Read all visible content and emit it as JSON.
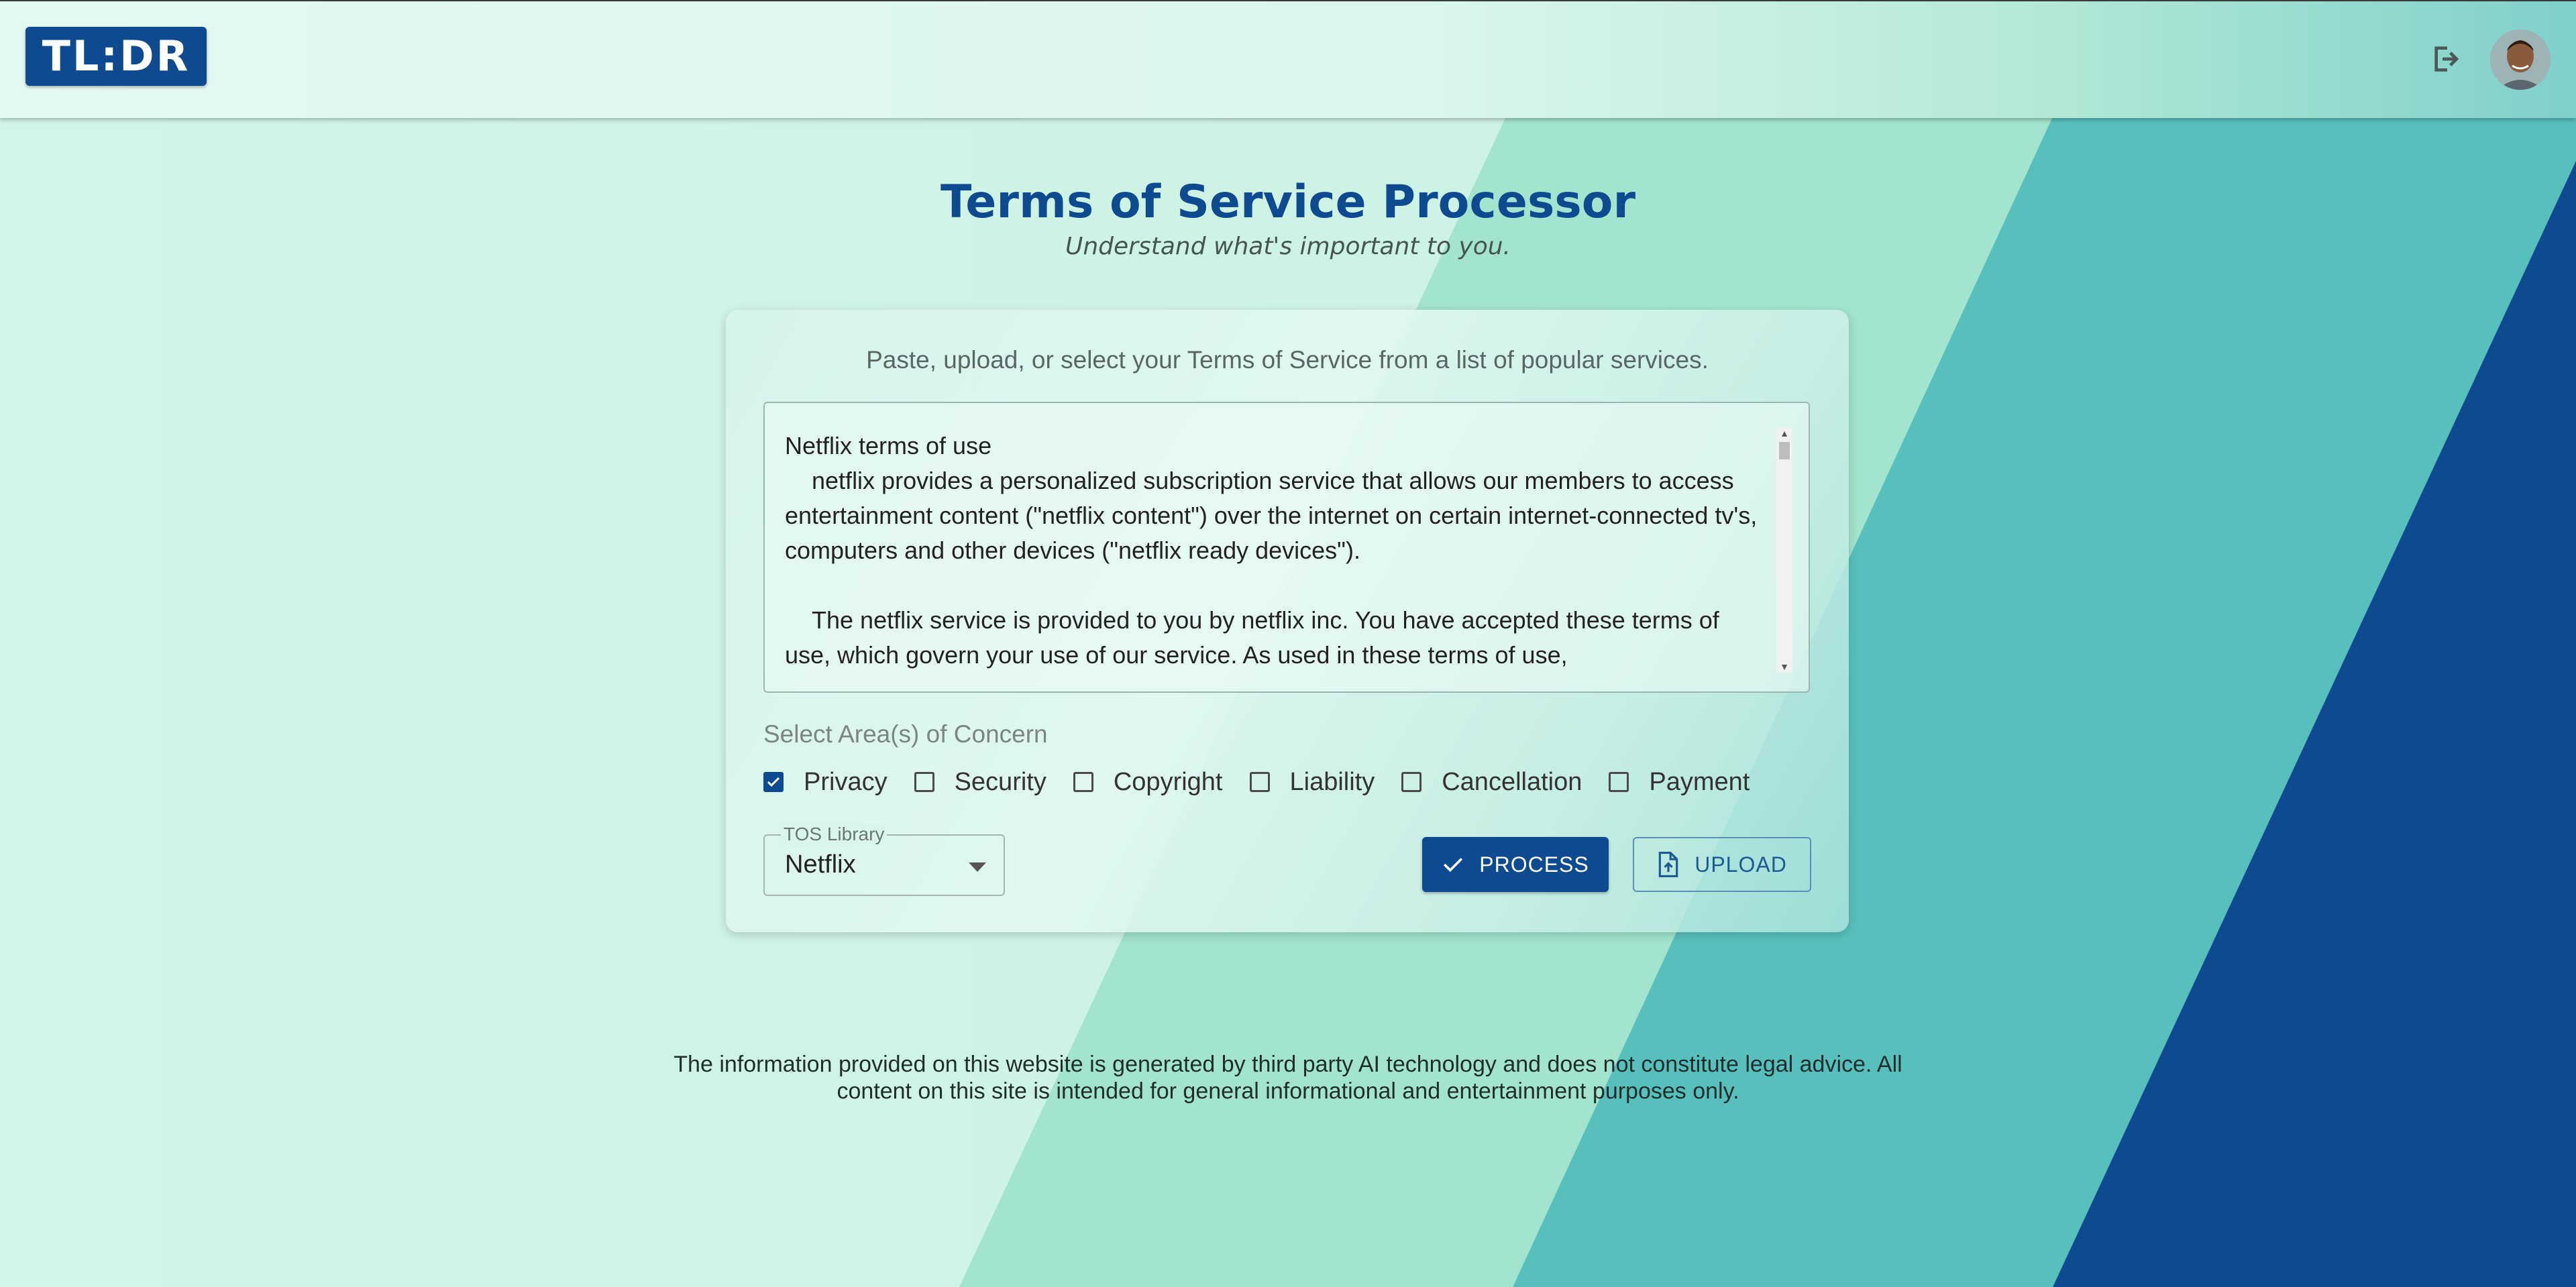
{
  "header": {
    "logo": "TL:DR",
    "logout_icon": "logout-icon",
    "avatar_icon": "user-avatar"
  },
  "main": {
    "title": "Terms of Service Processor",
    "subtitle": "Understand what's important to you."
  },
  "card": {
    "intro": "Paste, upload, or select your Terms of Service from a list of popular services.",
    "tos_text": "Netflix terms of use\n    netflix provides a personalized subscription service that allows our members to access entertainment content (\"netflix content\") over the internet on certain internet-connected tv's, computers and other devices (\"netflix ready devices\").\n\n    The netflix service is provided to you by netflix inc. You have accepted these terms of use, which govern your use of our service. As used in these terms of use,",
    "concern_label": "Select Area(s) of Concern",
    "concerns": [
      {
        "label": "Privacy",
        "checked": true
      },
      {
        "label": "Security",
        "checked": false
      },
      {
        "label": "Copyright",
        "checked": false
      },
      {
        "label": "Liability",
        "checked": false
      },
      {
        "label": "Cancellation",
        "checked": false
      },
      {
        "label": "Payment",
        "checked": false
      }
    ],
    "library": {
      "label": "TOS Library",
      "value": "Netflix"
    },
    "process_label": "PROCESS",
    "upload_label": "UPLOAD"
  },
  "footer": {
    "disclaimer": "The information provided on this website is generated by third party AI technology and does not constitute legal advice. All content on this site is intended for general informational and entertainment purposes only."
  },
  "colors": {
    "brand": "#0e4a8f",
    "bg_mint": "#cdf3e5",
    "bg_green": "#a2e4cd",
    "bg_teal": "#58c0bc",
    "bg_navy": "#0e4a8f"
  }
}
